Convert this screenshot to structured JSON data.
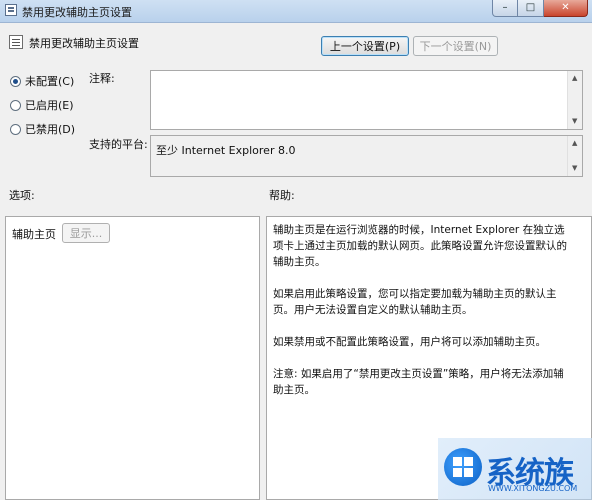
{
  "window": {
    "title": "禁用更改辅助主页设置",
    "min_glyph": "–",
    "max_glyph": "□",
    "close_glyph": "✕"
  },
  "header": {
    "policy_name": "禁用更改辅助主页设置",
    "prev_button": "上一个设置(P)",
    "next_button": "下一个设置(N)"
  },
  "state": {
    "options": [
      {
        "label": "未配置(C)",
        "checked": true
      },
      {
        "label": "已启用(E)",
        "checked": false
      },
      {
        "label": "已禁用(D)",
        "checked": false
      }
    ]
  },
  "comment": {
    "label": "注释:",
    "value": ""
  },
  "supported": {
    "label": "支持的平台:",
    "value": "至少 Internet Explorer 8.0"
  },
  "options_section": {
    "label": "选项:",
    "field_label": "辅助主页",
    "show_button": "显示..."
  },
  "help_section": {
    "label": "帮助:",
    "paragraphs": [
      "辅助主页是在运行浏览器的时候，Internet Explorer 在独立选项卡上通过主页加载的默认网页。此策略设置允许您设置默认的辅助主页。",
      "如果启用此策略设置，您可以指定要加载为辅助主页的默认主页。用户无法设置自定义的默认辅助主页。",
      "如果禁用或不配置此策略设置，用户将可以添加辅助主页。",
      "注意: 如果启用了“禁用更改主页设置”策略，用户将无法添加辅助主页。"
    ]
  },
  "watermark": {
    "brand": "系统族",
    "url": "WWW.XITONGZU.COM"
  }
}
